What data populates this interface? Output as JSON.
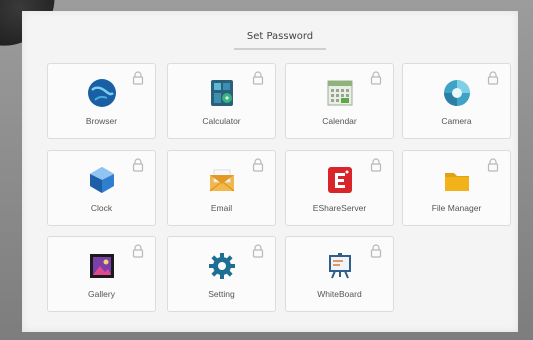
{
  "header": {
    "title": "Set Password"
  },
  "apps": [
    {
      "label": "Browser",
      "icon": "browser-icon"
    },
    {
      "label": "Calculator",
      "icon": "calculator-icon"
    },
    {
      "label": "Calendar",
      "icon": "calendar-icon"
    },
    {
      "label": "Camera",
      "icon": "camera-icon"
    },
    {
      "label": "Clock",
      "icon": "clock-icon"
    },
    {
      "label": "Email",
      "icon": "email-icon"
    },
    {
      "label": "EShareServer",
      "icon": "eshare-icon"
    },
    {
      "label": "File Manager",
      "icon": "folder-icon"
    },
    {
      "label": "Gallery",
      "icon": "gallery-icon"
    },
    {
      "label": "Setting",
      "icon": "gear-icon"
    },
    {
      "label": "WhiteBoard",
      "icon": "whiteboard-icon"
    }
  ],
  "colors": {
    "screen_bg": "#f4f4f4",
    "tile_border": "#dcdcdc",
    "eshare_red": "#d9252a",
    "folder_yellow": "#f2b21a",
    "gear_blue": "#1e6f93"
  }
}
